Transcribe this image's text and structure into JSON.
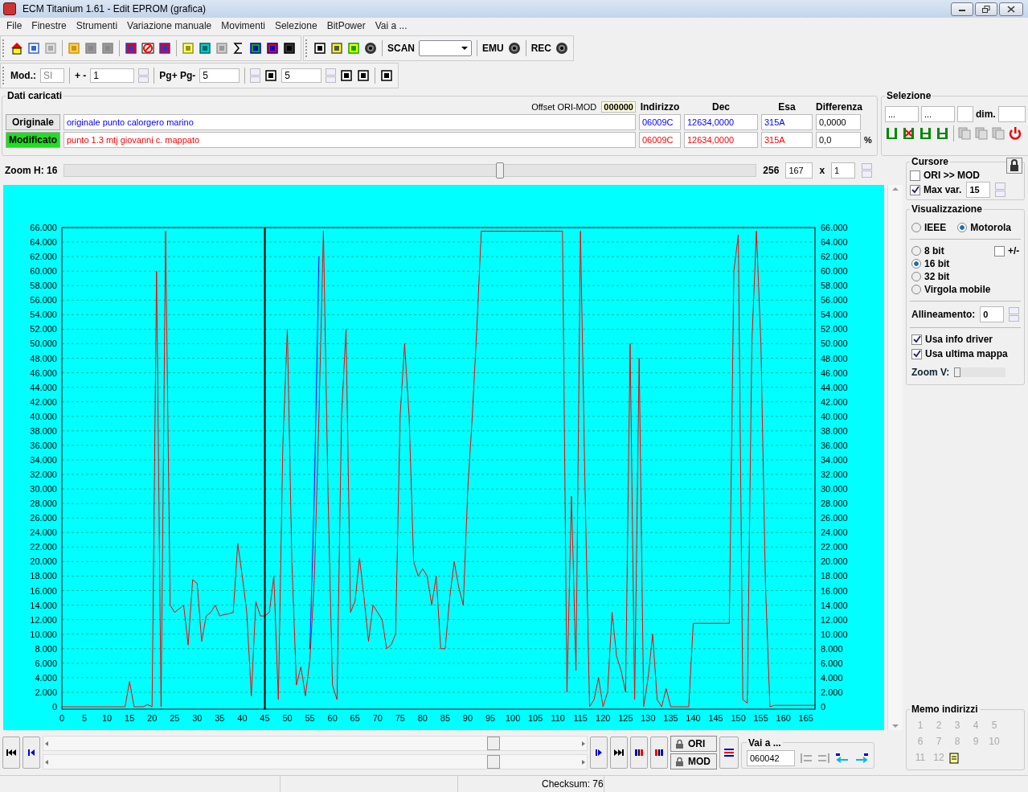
{
  "window": {
    "title": "ECM Titanium 1.61 - Edit EPROM (grafica)"
  },
  "menu": [
    "File",
    "Finestre",
    "Strumenti",
    "Variazione manuale",
    "Movimenti",
    "Selezione",
    "BitPower",
    "Vai a ..."
  ],
  "toolbar": {
    "scan_label": "SCAN",
    "emu_label": "EMU",
    "rec_label": "REC"
  },
  "toolbar2": {
    "mod_label": "Mod.:",
    "mod_value": "SI",
    "step_label": "+ -",
    "step_value": "1",
    "page_label": "Pg+ Pg-",
    "page_value": "5",
    "p_value": "5"
  },
  "dati": {
    "title": "Dati caricati",
    "offset_label": "Offset ORI-MOD",
    "offset_value": "000000",
    "columns": [
      "Indirizzo",
      "Dec",
      "Esa",
      "Differenza"
    ],
    "rows": [
      {
        "label": "Originale",
        "selected": false,
        "color": "#0000ff",
        "name": "originale punto calorgero marino",
        "address": "06009C",
        "dec": "12634,0000",
        "hex": "315A",
        "diff": "0,0000"
      },
      {
        "label": "Modificato",
        "selected": true,
        "color": "#ff0000",
        "name": "punto 1.3 mtj giovanni c. mappato",
        "address": "06009C",
        "dec": "12634,0000",
        "hex": "315A",
        "diff": "0,0",
        "unit": "%"
      }
    ]
  },
  "selezione": {
    "title": "Selezione",
    "fields": [
      "...",
      "..."
    ],
    "dim_label": "dim."
  },
  "zoom_h": {
    "label": "Zoom H: 16",
    "level": 0.63,
    "max": "256",
    "value": "167",
    "times": "x",
    "factor": "1"
  },
  "chart": {
    "chart_data": {
      "type": "line",
      "ylim": [
        0,
        66
      ],
      "categories": [
        "0",
        null,
        null,
        null,
        null,
        "5",
        null,
        null,
        null,
        null,
        "10",
        null,
        null,
        null,
        null,
        "15",
        null,
        null,
        null,
        null,
        "20",
        null,
        null,
        null,
        null,
        "25",
        null,
        null,
        null,
        null,
        "30",
        null,
        null,
        null,
        null,
        "35",
        null,
        null,
        null,
        null,
        "40",
        null,
        null,
        null,
        null,
        "45",
        null,
        null,
        null,
        null,
        "50",
        null,
        null,
        null,
        null,
        "55",
        null,
        null,
        null,
        null,
        "60",
        null,
        null,
        null,
        null,
        "65",
        null,
        null,
        null,
        null,
        "70",
        null,
        null,
        null,
        null,
        "75",
        null,
        null,
        null,
        null,
        "80",
        null,
        null,
        null,
        null,
        "85",
        null,
        null,
        null,
        null,
        "90",
        null,
        null,
        null,
        null,
        "95",
        null,
        null,
        null,
        null,
        "100",
        null,
        null,
        null,
        null,
        "105",
        null,
        null,
        null,
        null,
        "110",
        null,
        null,
        null,
        null,
        "115",
        null,
        null,
        null,
        null,
        "120",
        null,
        null,
        null,
        null,
        "125",
        null,
        null,
        null,
        null,
        "130",
        null,
        null,
        null,
        null,
        "135",
        null,
        null,
        null,
        null,
        "140",
        null,
        null,
        null,
        null,
        "145",
        null,
        null,
        null,
        null,
        "150",
        null,
        null,
        null,
        null,
        "155",
        null,
        null,
        null,
        null,
        "160",
        null,
        null,
        null,
        null,
        "165",
        null,
        null
      ],
      "yticks": [
        {
          "value": 0,
          "label": "0"
        },
        {
          "value": 2,
          "label": "2.000"
        },
        {
          "value": 4,
          "label": "4.000"
        },
        {
          "value": 6,
          "label": "6.000"
        },
        {
          "value": 8,
          "label": "8.000"
        },
        {
          "value": 10,
          "label": "10.000"
        },
        {
          "value": 12,
          "label": "12.000"
        },
        {
          "value": 14,
          "label": "14.000"
        },
        {
          "value": 16,
          "label": "16.000"
        },
        {
          "value": 18,
          "label": "18.000"
        },
        {
          "value": 20,
          "label": "20.000"
        },
        {
          "value": 22,
          "label": "22.000"
        },
        {
          "value": 24,
          "label": "24.000"
        },
        {
          "value": 26,
          "label": "26.000"
        },
        {
          "value": 28,
          "label": "28.000"
        },
        {
          "value": 30,
          "label": "30.000"
        },
        {
          "value": 32,
          "label": "32.000"
        },
        {
          "value": 34,
          "label": "34.000"
        },
        {
          "value": 36,
          "label": "36.000"
        },
        {
          "value": 38,
          "label": "38.000"
        },
        {
          "value": 40,
          "label": "40.000"
        },
        {
          "value": 42,
          "label": "42.000"
        },
        {
          "value": 44,
          "label": "44.000"
        },
        {
          "value": 46,
          "label": "46.000"
        },
        {
          "value": 48,
          "label": "48.000"
        },
        {
          "value": 50,
          "label": "50.000"
        },
        {
          "value": 52,
          "label": "52.000"
        },
        {
          "value": 54,
          "label": "54.000"
        },
        {
          "value": 56,
          "label": "56.000"
        },
        {
          "value": 58,
          "label": "58.000"
        },
        {
          "value": 60,
          "label": "60.000"
        },
        {
          "value": 62,
          "label": "62.000"
        },
        {
          "value": 64,
          "label": "64.000"
        },
        {
          "value": 66,
          "label": "66.000"
        }
      ],
      "series": [
        {
          "color": "#0000ff",
          "values": [
            null,
            null,
            null,
            null,
            null,
            null,
            null,
            null,
            null,
            null,
            null,
            null,
            null,
            null,
            null,
            null,
            null,
            null,
            null,
            null,
            null,
            null,
            null,
            null,
            null,
            null,
            null,
            null,
            null,
            null,
            null,
            null,
            null,
            null,
            null,
            null,
            null,
            null,
            null,
            null,
            null,
            null,
            null,
            null,
            null,
            null,
            null,
            null,
            null,
            null,
            null,
            null,
            null,
            null,
            null,
            8,
            30,
            62,
            null,
            null,
            null,
            null,
            null,
            null,
            null,
            null,
            null,
            null,
            null,
            null,
            null,
            null,
            null,
            null,
            null,
            null,
            null,
            null,
            null,
            null,
            null,
            null,
            null,
            null,
            null,
            null,
            null,
            null,
            null,
            null,
            null,
            null,
            null,
            null,
            null,
            null,
            null,
            null,
            null,
            null,
            null,
            null,
            null,
            null,
            null,
            null,
            null,
            null,
            null,
            null,
            null,
            null,
            null,
            null,
            null,
            null,
            null,
            null,
            null,
            null,
            null,
            null,
            null,
            null,
            null,
            null,
            null,
            null,
            null,
            null,
            null,
            null,
            null,
            null,
            null,
            null,
            null,
            null,
            null,
            null,
            null,
            null,
            null,
            null,
            null,
            null,
            null,
            null,
            null,
            null,
            null,
            null,
            null,
            null,
            null,
            null,
            null,
            null,
            null,
            null,
            null,
            null,
            null,
            null,
            null,
            null,
            null,
            null
          ]
        },
        {
          "color": "#ff0000",
          "values": [
            0,
            0,
            0,
            0,
            0,
            0,
            0,
            0,
            0,
            0,
            0,
            0,
            0,
            0,
            0,
            3.5,
            0,
            0,
            0,
            0.3,
            0,
            60,
            0,
            65.5,
            14,
            13,
            13.5,
            14,
            8.5,
            17.5,
            17,
            9,
            12.5,
            13,
            14,
            12.5,
            12.7,
            12.8,
            13,
            22.5,
            18,
            13,
            1.5,
            14.5,
            12.5,
            12.5,
            13,
            18,
            1,
            36,
            52,
            20,
            3,
            5.5,
            1.5,
            6.5,
            18,
            40,
            65.5,
            30,
            3,
            1,
            40,
            52,
            13,
            14.5,
            20.5,
            15,
            9,
            14,
            13,
            12,
            8,
            8.5,
            10,
            40,
            50,
            40,
            20,
            18,
            19,
            18,
            14,
            18,
            8,
            8,
            15,
            20,
            16.5,
            14,
            30,
            40,
            52,
            65.5,
            65.5,
            65.5,
            65.5,
            65.5,
            65.5,
            65.5,
            65.5,
            65.5,
            65.5,
            65.5,
            65.5,
            65.5,
            65.5,
            65.5,
            65.5,
            65.5,
            65.5,
            65.5,
            2,
            29,
            5,
            65.5,
            30,
            0,
            1,
            4,
            0,
            2,
            13,
            7,
            5,
            2,
            50,
            1,
            48,
            0,
            4,
            10,
            1,
            0,
            2.5,
            0,
            0,
            0,
            0,
            0,
            11.5,
            11.5,
            11.5,
            11.5,
            11.5,
            11.5,
            11.5,
            11.5,
            11.5,
            60,
            65,
            1,
            0.5,
            50,
            65.5,
            50,
            17,
            0,
            0.2,
            0.2,
            0.2,
            0.2,
            0.2,
            0.2,
            0.2,
            0.2,
            0.2,
            0.2
          ]
        }
      ],
      "grid": true,
      "ref_lines": [
        {
          "axis": "x",
          "value": "45"
        }
      ]
    }
  },
  "cursore": {
    "title": "Cursore",
    "ori_mod": {
      "label": "ORI >> MOD",
      "checked": false
    },
    "max_var": {
      "label": "Max var.",
      "checked": true,
      "value": "15"
    }
  },
  "visualizzazione": {
    "title": "Visualizzazione",
    "format": [
      {
        "label": "IEEE",
        "selected": false
      },
      {
        "label": "Motorola",
        "selected": true
      }
    ],
    "sign": {
      "label": "+/-",
      "checked": false
    },
    "width": [
      {
        "label": "8 bit",
        "selected": false
      },
      {
        "label": "16 bit",
        "selected": true
      },
      {
        "label": "32 bit",
        "selected": false
      },
      {
        "label": "Virgola mobile",
        "selected": false
      }
    ],
    "align_label": "Allineamento:",
    "align_value": "0",
    "options": [
      {
        "label": "Usa info driver",
        "checked": true
      },
      {
        "label": "Usa ultima mappa",
        "checked": true
      }
    ],
    "zoom_v": {
      "label": "Zoom V:",
      "level": 0
    }
  },
  "navigation": {
    "ori_label": "ORI",
    "mod_label": "MOD",
    "goto_title": "Vai a ...",
    "goto_value": "060042"
  },
  "memo": {
    "title": "Memo indirizzi",
    "disabled": true,
    "items": [
      "1",
      "2",
      "3",
      "4",
      "5",
      "6",
      "7",
      "8",
      "9",
      "10",
      "11",
      "12"
    ]
  },
  "status_bar": {
    "checksum": "Checksum: 76"
  }
}
